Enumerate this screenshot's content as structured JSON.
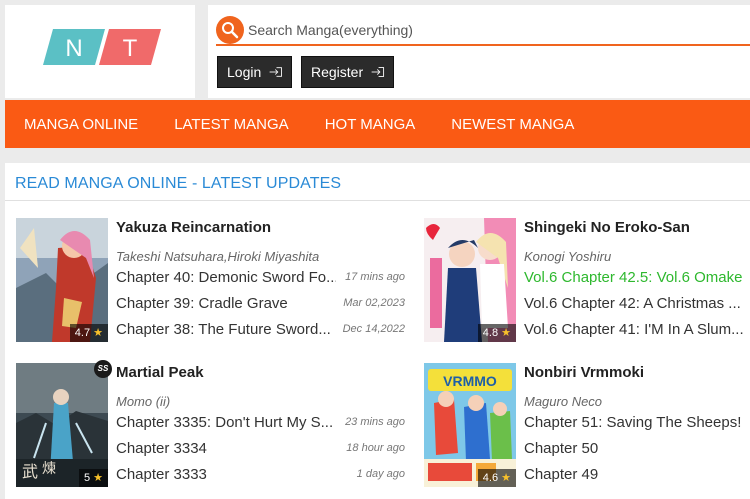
{
  "logo": {
    "letters": [
      "N",
      "T"
    ],
    "colors": [
      "#5bc0c5",
      "#f06a6a"
    ]
  },
  "search": {
    "placeholder": "Search Manga(everything)",
    "value": ""
  },
  "auth": {
    "login_label": "Login",
    "register_label": "Register"
  },
  "nav": {
    "items": [
      "MANGA ONLINE",
      "LATEST MANGA",
      "HOT MANGA",
      "NEWEST MANGA"
    ]
  },
  "section": {
    "title": "READ MANGA ONLINE - LATEST UPDATES"
  },
  "theme": {
    "accent": "#fa5a14",
    "link_blue": "#2a8ad6",
    "highlight_green": "#2eb82e",
    "star": "#f8c12a"
  },
  "manga": [
    {
      "title": "Yakuza Reincarnation",
      "author": "Takeshi Natsuhara,Hiroki Miyashita",
      "rating": "4.7",
      "chapters": [
        {
          "name": "Chapter 40: Demonic Sword Fo...",
          "time": "17 mins ago"
        },
        {
          "name": "Chapter 39: Cradle Grave",
          "time": "Mar 02,2023"
        },
        {
          "name": "Chapter 38: The Future Sword...",
          "time": "Dec 14,2022"
        }
      ]
    },
    {
      "title": "Shingeki No Eroko-San",
      "author": "Konogi Yoshiru",
      "rating": "4.8",
      "chapters": [
        {
          "name": "Vol.6 Chapter 42.5: Vol.6 Omake",
          "time": ""
        },
        {
          "name": "Vol.6 Chapter 42: A Christmas ...",
          "time": ""
        },
        {
          "name": "Vol.6 Chapter 41: I'M In A Slum...",
          "time": ""
        }
      ]
    },
    {
      "title": "Martial Peak",
      "author": "Momo (ii)",
      "rating": "5",
      "badge": "SS",
      "chapters": [
        {
          "name": "Chapter 3335: Don't Hurt My S...",
          "time": "23 mins ago"
        },
        {
          "name": "Chapter 3334",
          "time": "18 hour ago"
        },
        {
          "name": "Chapter 3333",
          "time": "1 day ago"
        }
      ]
    },
    {
      "title": "Nonbiri Vrmmoki",
      "author": "Maguro Neco",
      "rating": "4.6",
      "chapters": [
        {
          "name": "Chapter 51: Saving The Sheeps!",
          "time": ""
        },
        {
          "name": "Chapter 50",
          "time": ""
        },
        {
          "name": "Chapter 49",
          "time": ""
        }
      ]
    }
  ]
}
